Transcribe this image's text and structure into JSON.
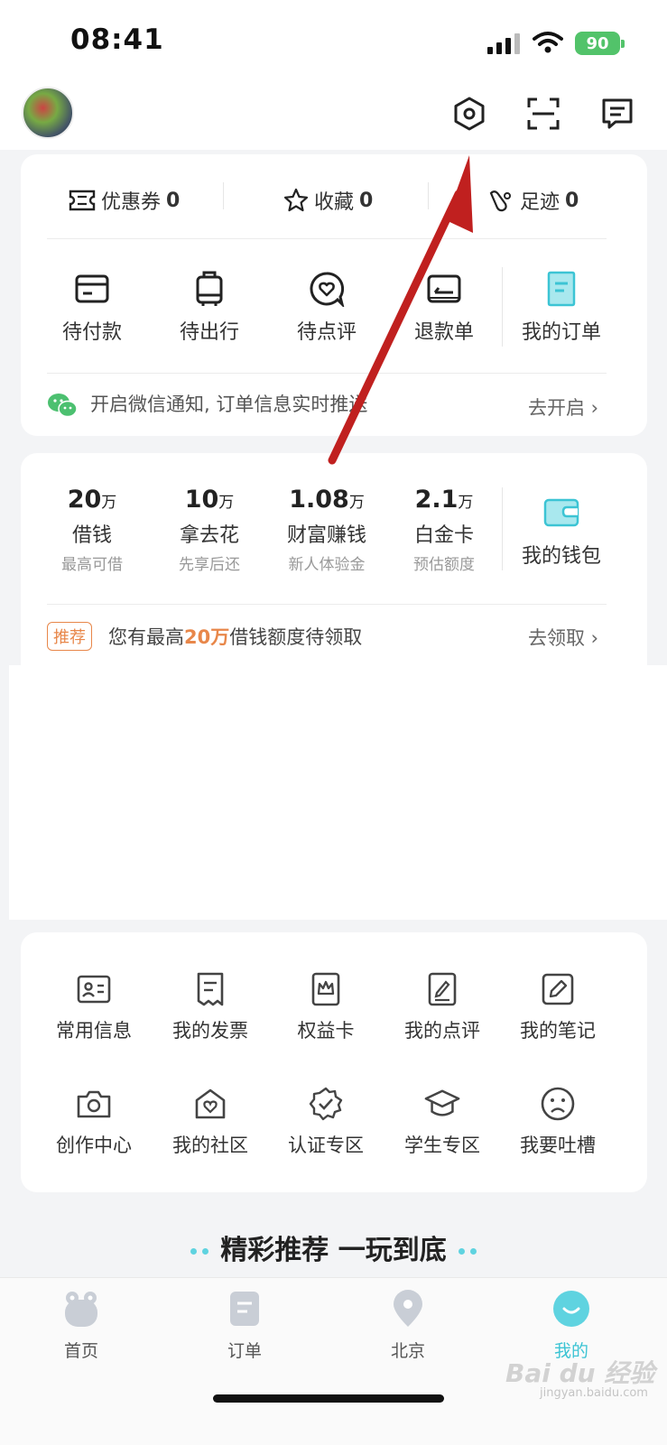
{
  "status": {
    "time": "08:41",
    "battery": "90"
  },
  "header": {
    "avatar": "avatar",
    "icons": [
      "settings-icon",
      "scan-icon",
      "message-icon"
    ]
  },
  "stats": [
    {
      "label": "优惠券",
      "count": "0"
    },
    {
      "label": "收藏",
      "count": "0"
    },
    {
      "label": "足迹",
      "count": "0"
    }
  ],
  "orders": [
    {
      "label": "待付款"
    },
    {
      "label": "待出行"
    },
    {
      "label": "待点评"
    },
    {
      "label": "退款单"
    },
    {
      "label": "我的订单"
    }
  ],
  "wechat": {
    "text": "开启微信通知, 订单信息实时推送",
    "action": "去开启"
  },
  "finance": [
    {
      "num": "20",
      "unit": "万",
      "title": "借钱",
      "sub": "最高可借"
    },
    {
      "num": "10",
      "unit": "万",
      "title": "拿去花",
      "sub": "先享后还"
    },
    {
      "num": "1.08",
      "unit": "万",
      "title": "财富赚钱",
      "sub": "新人体验金"
    },
    {
      "num": "2.1",
      "unit": "万",
      "title": "白金卡",
      "sub": "预估额度"
    }
  ],
  "wallet": {
    "label": "我的钱包"
  },
  "promo": {
    "badge": "推荐",
    "prefix": "您有最高",
    "highlight": "20万",
    "suffix": "借钱额度待领取",
    "action": "去领取"
  },
  "services": [
    {
      "label": "常用信息"
    },
    {
      "label": "我的发票"
    },
    {
      "label": "权益卡"
    },
    {
      "label": "我的点评"
    },
    {
      "label": "我的笔记"
    },
    {
      "label": "创作中心"
    },
    {
      "label": "我的社区"
    },
    {
      "label": "认证专区"
    },
    {
      "label": "学生专区"
    },
    {
      "label": "我要吐槽"
    }
  ],
  "banner": {
    "text": "精彩推荐 一玩到底"
  },
  "tabs": [
    {
      "label": "首页"
    },
    {
      "label": "订单"
    },
    {
      "label": "北京"
    },
    {
      "label": "我的"
    }
  ],
  "colors": {
    "accent": "#5fd3e0",
    "orange": "#e8874a",
    "battery": "#52c36a",
    "annotation_arrow": "#c0201f"
  },
  "watermark": {
    "text": "Bai du 经验",
    "url": "jingyan.baidu.com"
  }
}
